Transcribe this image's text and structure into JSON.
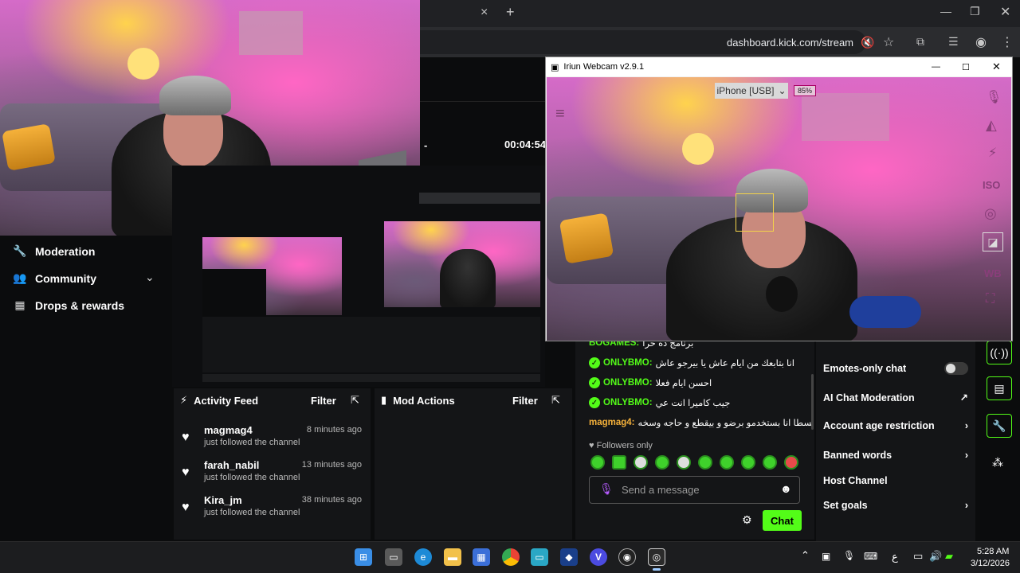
{
  "browser": {
    "url": "dashboard.kick.com/stream",
    "close_tab": "×",
    "new_tab": "+"
  },
  "stream_stats": {
    "dash": "-",
    "time": "00:04:54"
  },
  "sidebar": {
    "items": [
      {
        "label": "Moderation",
        "icon": "wrench-icon"
      },
      {
        "label": "Community",
        "icon": "community-icon"
      },
      {
        "label": "Drops & rewards",
        "icon": "drops-icon"
      }
    ]
  },
  "activity_feed": {
    "title": "Activity Feed",
    "filter": "Filter",
    "items": [
      {
        "name": "magmag4",
        "action": "just followed the channel",
        "time": "8 minutes ago"
      },
      {
        "name": "farah_nabil",
        "action": "just followed the channel",
        "time": "13 minutes ago"
      },
      {
        "name": "Kira_jm",
        "action": "just followed the channel",
        "time": "38 minutes ago"
      }
    ]
  },
  "mod_actions": {
    "title": "Mod Actions",
    "filter": "Filter"
  },
  "chat": {
    "messages": [
      {
        "user": "BOGAMES:",
        "text": "برنامج ده حرا"
      },
      {
        "user": "ONLYBMO:",
        "text": "انا بتابعك من ايام عاش يا بيرجو عاش"
      },
      {
        "user": "ONLYBMO:",
        "text": "احسن ايام فعلا"
      },
      {
        "user": "ONLYBMO:",
        "text": "جيب كاميرا انت عي"
      },
      {
        "user": "magmag4:",
        "text": "بسطا انا بستخدمو برضو و بيقطع و حاجه وسخه"
      }
    ],
    "followers_only": "Followers only",
    "placeholder": "Send a message",
    "send": "Chat"
  },
  "settings": {
    "emotes_only": "Emotes-only chat",
    "ai_moderation": "AI Chat Moderation",
    "account_age": "Account age restriction",
    "banned_words": "Banned words",
    "host_channel": "Host Channel",
    "set_goals": "Set goals"
  },
  "iriun": {
    "title": "Iriun Webcam v2.9.1",
    "device": "iPhone [USB]",
    "battery": "85%",
    "iso": "ISO",
    "wb": "WB"
  },
  "taskbar": {
    "time": "5:28 AM",
    "date": "3/12/2026",
    "lang": "ع"
  },
  "colors": {
    "accent": "#53fc18",
    "panel": "#141517",
    "bg": "#0b0c0d"
  }
}
